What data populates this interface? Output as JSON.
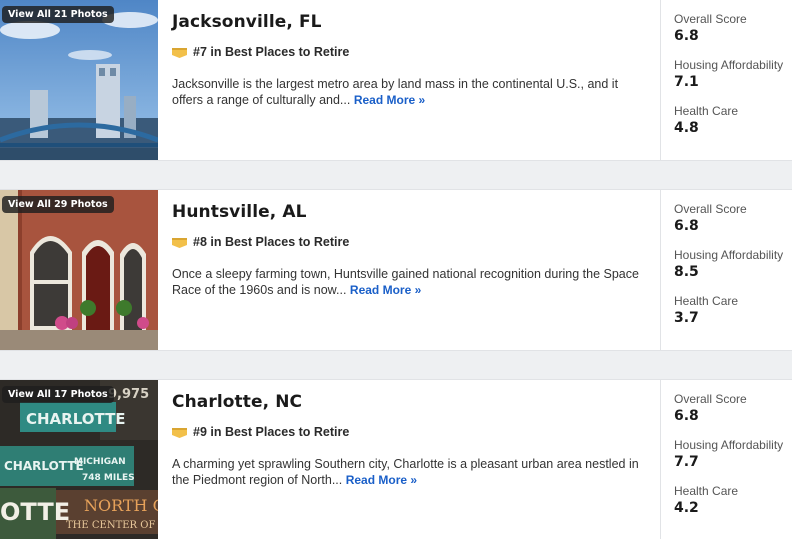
{
  "listings": [
    {
      "photos_label": "View All 21 Photos",
      "city": "Jacksonville, FL",
      "rank": "#7 in Best Places to Retire",
      "description": "Jacksonville is the largest metro area by land mass in the continental U.S., and it offers a range of culturally and...",
      "read_more": "Read More »",
      "overall_label": "Overall Score",
      "overall": "6.8",
      "housing_label": "Housing Affordability",
      "housing": "7.1",
      "health_label": "Health Care",
      "health": "4.8"
    },
    {
      "photos_label": "View All 29 Photos",
      "city": "Huntsville, AL",
      "rank": "#8 in Best Places to Retire",
      "description": "Once a sleepy farming town, Huntsville gained national recognition during the Space Race of the 1960s and is now...",
      "read_more": "Read More »",
      "overall_label": "Overall Score",
      "overall": "6.8",
      "housing_label": "Housing Affordability",
      "housing": "8.5",
      "health_label": "Health Care",
      "health": "3.7"
    },
    {
      "photos_label": "View All 17 Photos",
      "city": "Charlotte, NC",
      "rank": "#9 in Best Places to Retire",
      "description": "A charming yet sprawling Southern city, Charlotte is a pleasant urban area nestled in the Piedmont region of North...",
      "read_more": "Read More »",
      "overall_label": "Overall Score",
      "overall": "6.8",
      "housing_label": "Housing Affordability",
      "housing": "7.7",
      "health_label": "Health Care",
      "health": "4.2"
    }
  ],
  "photo_signs": {
    "charlotte_sign_1": "CHARLOTTE",
    "charlotte_sign_2": "CHARLOTTE",
    "charlotte_sign_3": "MICHIGAN",
    "charlotte_sign_4": "748 MILES",
    "charlotte_sign_5": "NORTH C",
    "charlotte_sign_6": "THE CENTER OF TH",
    "charlotte_sign_7": "9,975",
    "charlotte_sign_8": "OTTE"
  },
  "colors": {
    "accent_link": "#1a5fc8",
    "medal": "#f2c04a"
  }
}
